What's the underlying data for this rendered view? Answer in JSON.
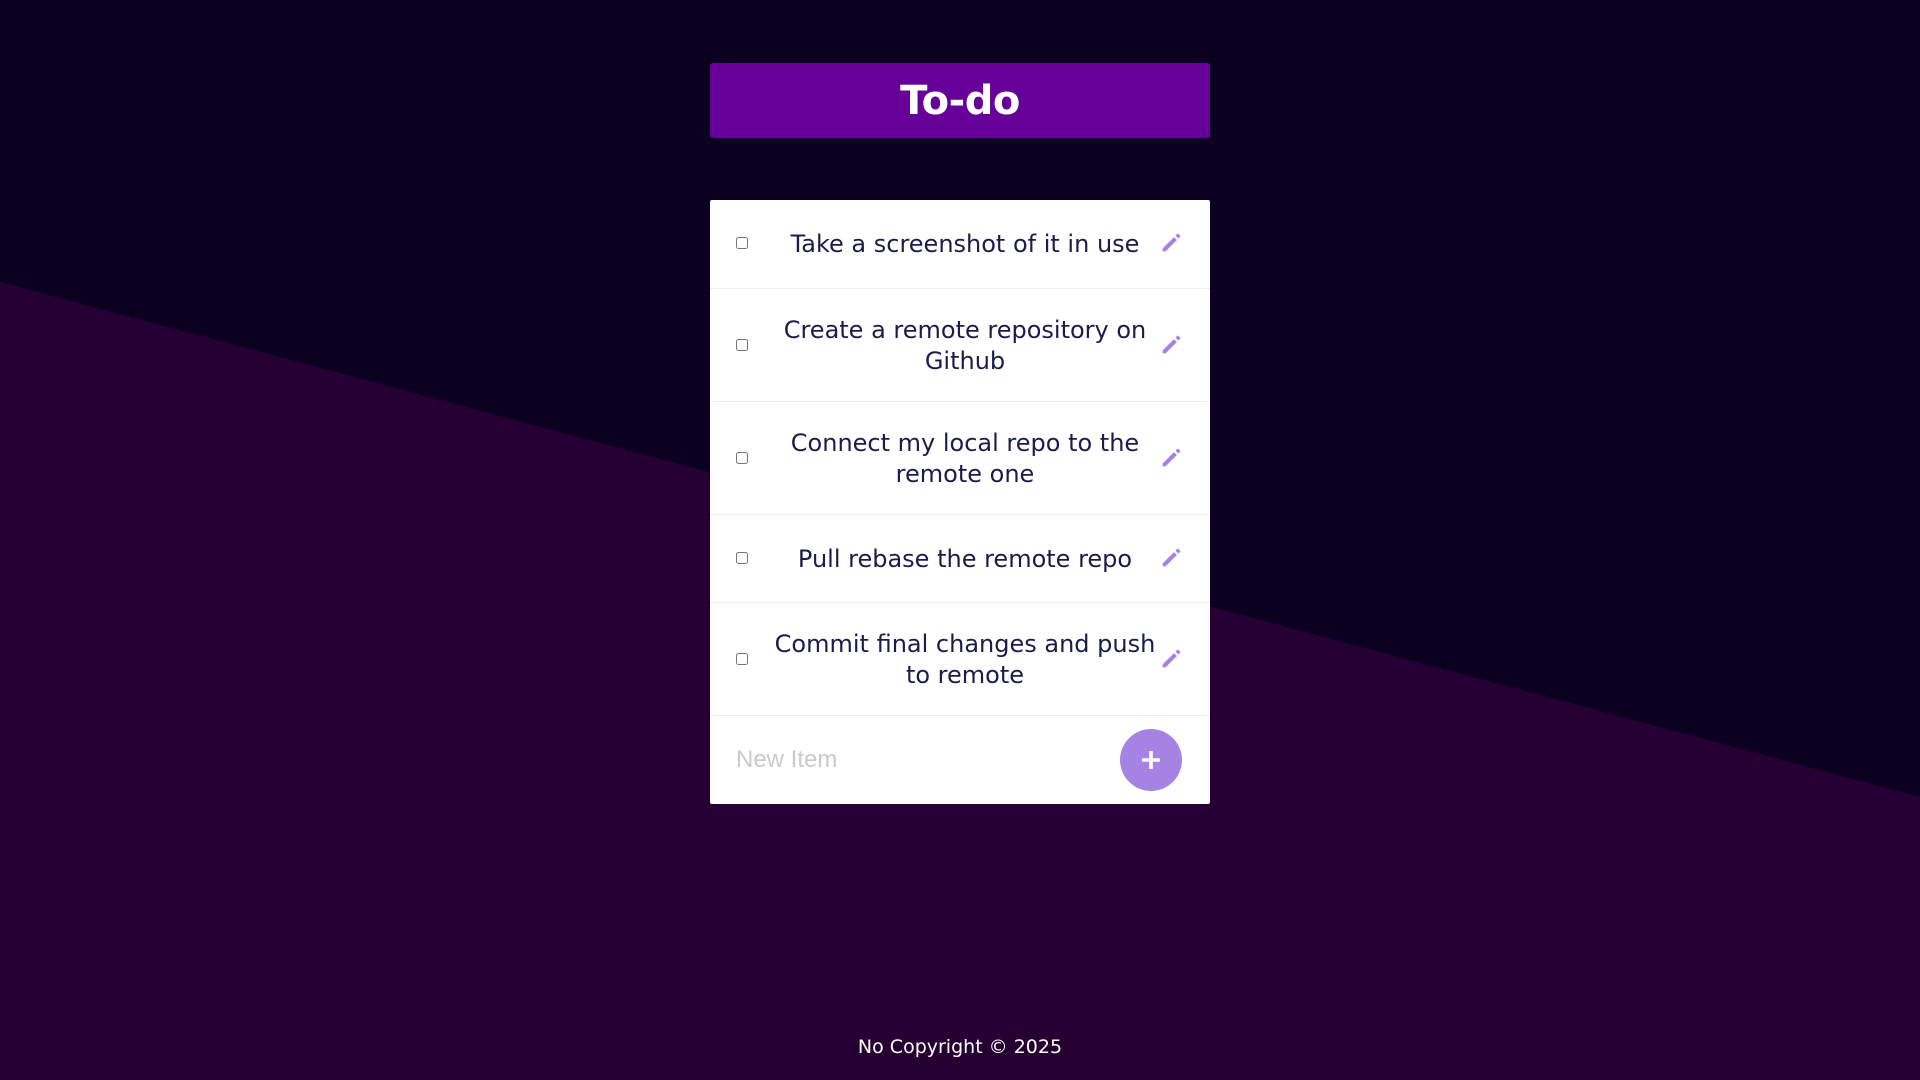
{
  "app": {
    "title": "To-do"
  },
  "items": [
    {
      "label": "Take a screenshot of it in use",
      "checked": false
    },
    {
      "label": "Create a remote repository on Github",
      "checked": false
    },
    {
      "label": "Connect my local repo to the remote one",
      "checked": false
    },
    {
      "label": "Pull rebase the remote repo",
      "checked": false
    },
    {
      "label": "Commit final changes and push to remote",
      "checked": false
    }
  ],
  "new_item": {
    "placeholder": "New Item",
    "value": "",
    "add_icon": "plus-icon"
  },
  "edit_icon": "pencil-icon",
  "footer": {
    "text": "No Copyright © 2025"
  },
  "colors": {
    "background_dark": "#0b0020",
    "background_purple": "#270033",
    "header": "#660099",
    "accent": "#a683e3",
    "item_text": "#1a1d4a"
  }
}
